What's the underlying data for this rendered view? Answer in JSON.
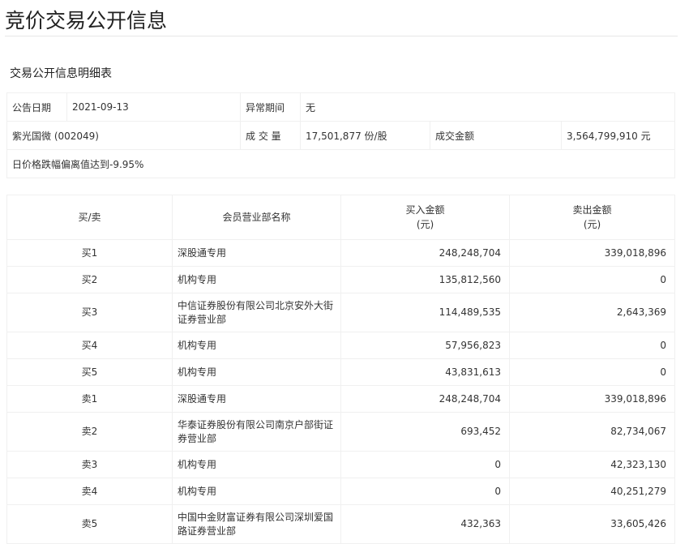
{
  "page_title": "竞价交易公开信息",
  "section_title": "交易公开信息明细表",
  "info": {
    "date_label": "公告日期",
    "date_value": "2021-09-13",
    "period_label": "异常期间",
    "period_value": "无",
    "stock": "紫光国微 (002049)",
    "volume_label": "成 交 量",
    "volume_value": "17,501,877 份/股",
    "amount_label": "成交金额",
    "amount_value": "3,564,799,910 元",
    "reason": "日价格跌幅偏离值达到-9.95%"
  },
  "table": {
    "headers": [
      "买/卖",
      "会员营业部名称",
      "买入金额\n(元)",
      "卖出金额\n(元)"
    ],
    "header_buy_1": "买入金额",
    "header_buy_2": "(元)",
    "header_sell_1": "卖出金额",
    "header_sell_2": "(元)",
    "rows": [
      {
        "side": "买1",
        "name": "深股通专用",
        "buy": "248,248,704",
        "sell": "339,018,896"
      },
      {
        "side": "买2",
        "name": "机构专用",
        "buy": "135,812,560",
        "sell": "0"
      },
      {
        "side": "买3",
        "name": "中信证券股份有限公司北京安外大街证券营业部",
        "buy": "114,489,535",
        "sell": "2,643,369"
      },
      {
        "side": "买4",
        "name": "机构专用",
        "buy": "57,956,823",
        "sell": "0"
      },
      {
        "side": "买5",
        "name": "机构专用",
        "buy": "43,831,613",
        "sell": "0"
      },
      {
        "side": "卖1",
        "name": "深股通专用",
        "buy": "248,248,704",
        "sell": "339,018,896"
      },
      {
        "side": "卖2",
        "name": "华泰证券股份有限公司南京户部街证券营业部",
        "buy": "693,452",
        "sell": "82,734,067"
      },
      {
        "side": "卖3",
        "name": "机构专用",
        "buy": "0",
        "sell": "42,323,130"
      },
      {
        "side": "卖4",
        "name": "机构专用",
        "buy": "0",
        "sell": "40,251,279"
      },
      {
        "side": "卖5",
        "name": "中国中金财富证券有限公司深圳爱国路证券营业部",
        "buy": "432,363",
        "sell": "33,605,426"
      }
    ]
  }
}
